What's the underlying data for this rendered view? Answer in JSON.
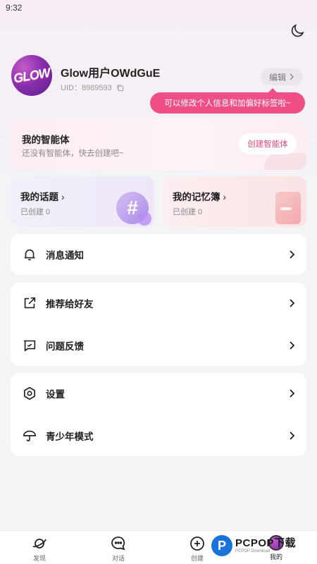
{
  "status_bar": {
    "time": "9:32"
  },
  "profile": {
    "avatar_text": "GLOW",
    "username": "Glow用户OWdGuE",
    "uid_label": "UID：8989593",
    "edit_label": "编辑",
    "tooltip": "可以修改个人信息和加偏好标签啦~"
  },
  "agent": {
    "title": "我的智能体",
    "subtitle": "还没有智能体，快去创建吧~",
    "create_label": "创建智能体"
  },
  "topics": {
    "title": "我的话题",
    "count_label": "已创建 0"
  },
  "memo": {
    "title": "我的记忆簿",
    "count_label": "已创建 0"
  },
  "menu": {
    "notifications": "消息通知",
    "recommend": "推荐给好友",
    "feedback": "问题反馈",
    "settings": "设置",
    "youth_mode": "青少年模式"
  },
  "tabbar": {
    "discover": "发现",
    "chat": "对话",
    "create": "创建",
    "mine": "我的"
  },
  "watermark": {
    "main": "PCPOP下载",
    "sub": "PCPOP Download"
  },
  "colors": {
    "accent": "#ef4f86",
    "create_btn_text": "#e2467a",
    "watermark_blue": "#1a73d9"
  },
  "icons": {
    "theme": "moon-icon",
    "copy": "copy-icon",
    "notifications": "bell-icon",
    "recommend": "share-icon",
    "feedback": "message-square-icon",
    "settings": "settings-icon",
    "youth_mode": "umbrella-icon"
  }
}
